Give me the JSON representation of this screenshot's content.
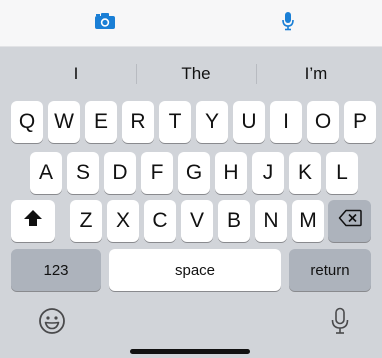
{
  "toolbar": {
    "camera_icon": "camera-icon",
    "mic_icon": "microphone-icon",
    "accent_color": "#1a7fd6"
  },
  "suggestions": [
    "I",
    "The",
    "I’m"
  ],
  "keyboard": {
    "row1": [
      "Q",
      "W",
      "E",
      "R",
      "T",
      "Y",
      "U",
      "I",
      "O",
      "P"
    ],
    "row2": [
      "A",
      "S",
      "D",
      "F",
      "G",
      "H",
      "J",
      "K",
      "L"
    ],
    "row3": [
      "Z",
      "X",
      "C",
      "V",
      "B",
      "N",
      "M"
    ],
    "shift_icon": "shift-icon",
    "delete_icon": "delete-icon",
    "numbers_label": "123",
    "space_label": "space",
    "return_label": "return"
  },
  "bottom_bar": {
    "emoji_icon": "emoji-icon",
    "dictation_icon": "dictation-mic-icon"
  }
}
